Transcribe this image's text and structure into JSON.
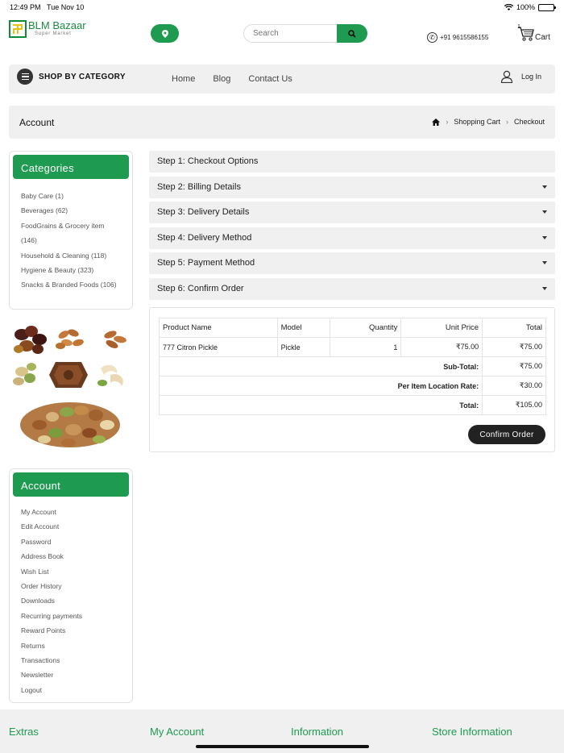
{
  "status_bar": {
    "time": "12:49 PM",
    "date": "Tue Nov 10",
    "battery": "100%"
  },
  "header": {
    "logo_title": "BLM Bazaar",
    "logo_subtitle": "Super Market",
    "search_placeholder": "Search",
    "phone": "+91 9615586155",
    "cart_count": "1",
    "cart_label": "Cart"
  },
  "nav": {
    "category_label": "SHOP BY CATEGORY",
    "links": [
      "Home",
      "Blog",
      "Contact Us"
    ],
    "login_label": "Log In"
  },
  "breadcrumb_bar": {
    "title": "Account",
    "items": [
      "Shopping Cart",
      "Checkout"
    ]
  },
  "categories": {
    "title": "Categories",
    "items": [
      "Baby Care (1)",
      "Beverages (62)",
      "FoodGrains & Grocery item (146)",
      "Household & Cleaning (118)",
      "Hygiene & Beauty (323)",
      "Snacks & Branded Foods (106)"
    ]
  },
  "account": {
    "title": "Account",
    "items": [
      "My Account",
      "Edit Account",
      "Password",
      "Address Book",
      "Wish List",
      "Order History",
      "Downloads",
      "Recurring payments",
      "Reward Points",
      "Returns",
      "Transactions",
      "Newsletter",
      "Logout"
    ]
  },
  "steps": [
    "Step 1: Checkout Options",
    "Step 2: Billing Details",
    "Step 3: Delivery Details",
    "Step 4: Delivery Method",
    "Step 5: Payment Method",
    "Step 6: Confirm Order"
  ],
  "order": {
    "headers": [
      "Product Name",
      "Model",
      "Quantity",
      "Unit Price",
      "Total"
    ],
    "row": {
      "name": "777 Citron Pickle",
      "model": "Pickle",
      "qty": "1",
      "unit": "₹75.00",
      "total": "₹75.00"
    },
    "totals": [
      {
        "label": "Sub-Total:",
        "value": "₹75.00"
      },
      {
        "label": "Per Item Location Rate:",
        "value": "₹30.00"
      },
      {
        "label": "Total:",
        "value": "₹105.00"
      }
    ],
    "confirm_label": "Confirm Order"
  },
  "footer": {
    "columns": [
      "Extras",
      "My Account",
      "Information",
      "Store Information"
    ]
  },
  "colors": {
    "brand_green": "#1e9b50",
    "panel_gray": "#f0f0f0"
  }
}
